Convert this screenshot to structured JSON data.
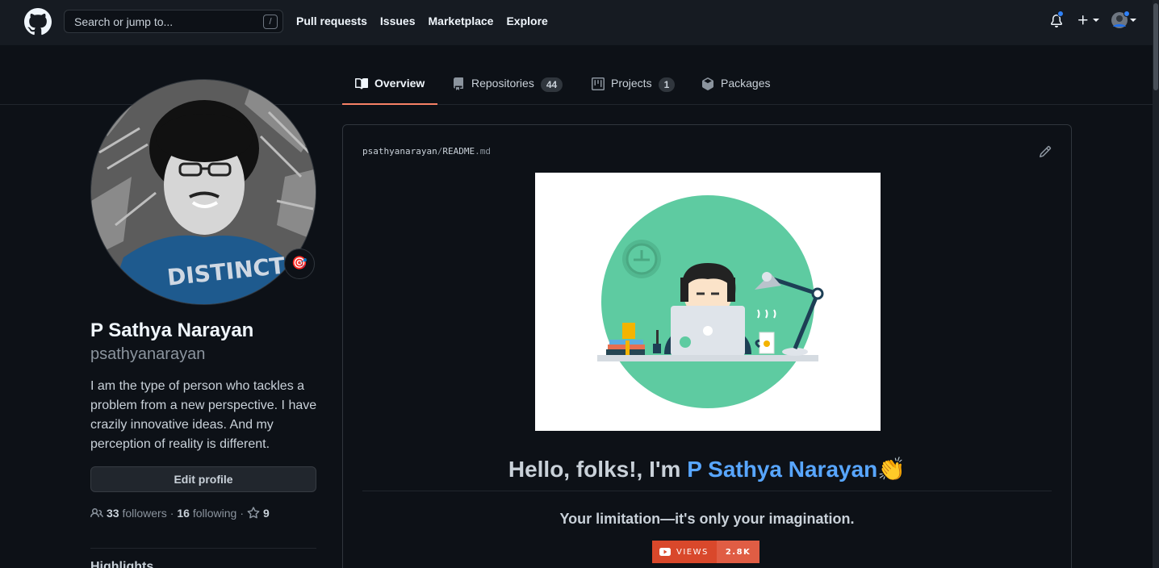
{
  "header": {
    "search_placeholder": "Search or jump to...",
    "search_shortcut": "/",
    "nav": [
      "Pull requests",
      "Issues",
      "Marketplace",
      "Explore"
    ],
    "plus_label": "+"
  },
  "tabs": [
    {
      "label": "Overview",
      "active": true
    },
    {
      "label": "Repositories",
      "count": "44"
    },
    {
      "label": "Projects",
      "count": "1"
    },
    {
      "label": "Packages"
    }
  ],
  "profile": {
    "name": "P Sathya Narayan",
    "username": "psathyanarayan",
    "status_emoji": "🎯",
    "bio": "I am the type of person who tackles a problem from a new perspective. I have crazily innovative ideas. And my perception of reality is different.",
    "edit_button": "Edit profile",
    "followers_count": "33",
    "followers_label": "followers",
    "following_count": "16",
    "following_label": "following",
    "stars_count": "9",
    "separator": "·",
    "next_heading": "Highlights"
  },
  "readme": {
    "owner": "psathyanarayan",
    "slash": "/",
    "file": "README",
    "ext": ".md",
    "greeting_prefix": "Hello, folks!, I'm ",
    "greeting_name": "P Sathya Narayan",
    "greeting_emoji": "👏",
    "quote": "Your limitation—it's only your imagination.",
    "badge_label": "VIEWS",
    "badge_value": "2.8K"
  },
  "colors": {
    "bg": "#0d1117",
    "header_bg": "#161b22",
    "accent_tab": "#f78166",
    "link": "#58a6ff",
    "banner_green": "#5ecba1",
    "badge_red": "#e05d44"
  },
  "icons": [
    "github-logo-icon",
    "bell-icon",
    "plus-icon",
    "book-icon",
    "repo-icon",
    "project-icon",
    "package-icon",
    "people-icon",
    "star-icon",
    "pencil-icon",
    "youtube-icon"
  ]
}
